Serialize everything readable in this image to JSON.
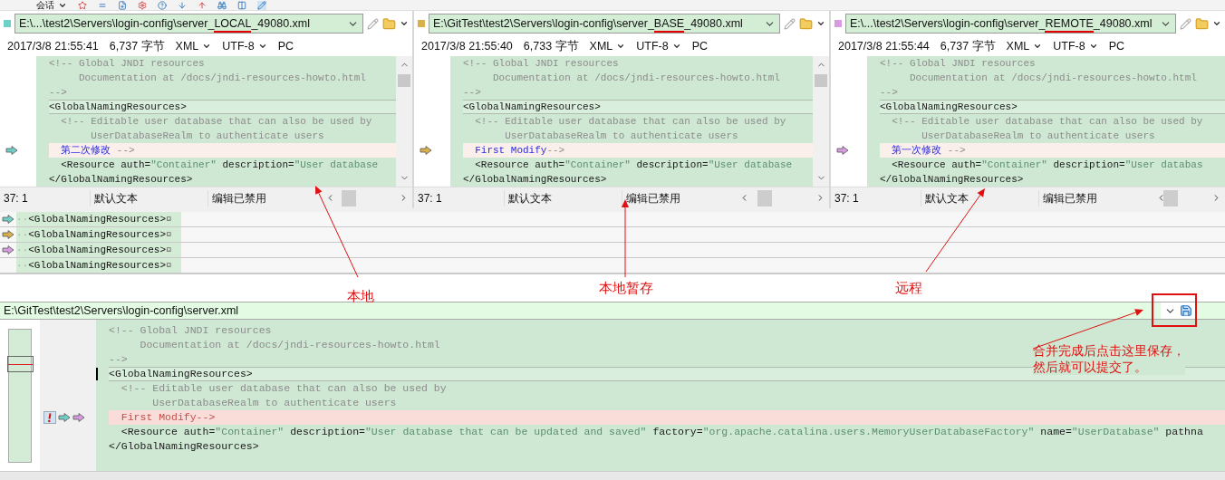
{
  "toolbar": {
    "session_label": "会话"
  },
  "panes": [
    {
      "color": "#6fd0c8",
      "path_parts": [
        "E:\\...\\test2\\Servers\\login-config\\server_",
        "LOCAL",
        "_49080.xml"
      ],
      "info": {
        "timestamp": "2017/3/8 21:55:41",
        "size": "6,737 字节",
        "syntax": "XML",
        "encoding": "UTF-8",
        "line_ending": "PC"
      },
      "lines": [
        {
          "current": false,
          "changed": false,
          "segments": [
            {
              "text": "<!-- Global JNDI resources",
              "kind": "comment"
            }
          ]
        },
        {
          "current": false,
          "changed": false,
          "segments": [
            {
              "text": "     Documentation at /docs/jndi-resources-howto.html",
              "kind": "comment"
            }
          ]
        },
        {
          "current": false,
          "changed": false,
          "segments": [
            {
              "text": "-->",
              "kind": "comment"
            }
          ]
        },
        {
          "current": true,
          "changed": false,
          "segments": [
            {
              "text": "<GlobalNamingResources>",
              "kind": "tag"
            }
          ]
        },
        {
          "current": false,
          "changed": false,
          "segments": [
            {
              "text": "  <!-- Editable user database that can also be used by",
              "kind": "comment"
            }
          ]
        },
        {
          "current": false,
          "changed": false,
          "segments": [
            {
              "text": "       UserDatabaseRealm to authenticate users",
              "kind": "comment"
            }
          ]
        },
        {
          "current": false,
          "changed": true,
          "segments": [
            {
              "text": "  第二次修改",
              "kind": "added"
            },
            {
              "text": " -->",
              "kind": "comment"
            }
          ]
        },
        {
          "current": false,
          "changed": false,
          "segments": [
            {
              "text": "  <Resource auth=",
              "kind": "tag"
            },
            {
              "text": "\"Container\"",
              "kind": "value"
            },
            {
              "text": " description=",
              "kind": "tag"
            },
            {
              "text": "\"User database",
              "kind": "value"
            }
          ]
        },
        {
          "current": false,
          "changed": false,
          "segments": [
            {
              "text": "</GlobalNamingResources>",
              "kind": "tag"
            }
          ]
        }
      ],
      "status": {
        "position": "37: 1",
        "mode": "默认文本",
        "edit_state": "编辑已禁用"
      },
      "annotation": "本地"
    },
    {
      "color": "#d9b04a",
      "path_parts": [
        "E:\\GitTest\\test2\\Servers\\login-config\\server_",
        "BASE",
        "_49080.xml"
      ],
      "info": {
        "timestamp": "2017/3/8 21:55:40",
        "size": "6,733 字节",
        "syntax": "XML",
        "encoding": "UTF-8",
        "line_ending": "PC"
      },
      "lines": [
        {
          "current": false,
          "changed": false,
          "segments": [
            {
              "text": "<!-- Global JNDI resources",
              "kind": "comment"
            }
          ]
        },
        {
          "current": false,
          "changed": false,
          "segments": [
            {
              "text": "     Documentation at /docs/jndi-resources-howto.html",
              "kind": "comment"
            }
          ]
        },
        {
          "current": false,
          "changed": false,
          "segments": [
            {
              "text": "-->",
              "kind": "comment"
            }
          ]
        },
        {
          "current": true,
          "changed": false,
          "segments": [
            {
              "text": "<GlobalNamingResources>",
              "kind": "tag"
            }
          ]
        },
        {
          "current": false,
          "changed": false,
          "segments": [
            {
              "text": "  <!-- Editable user database that can also be used by",
              "kind": "comment"
            }
          ]
        },
        {
          "current": false,
          "changed": false,
          "segments": [
            {
              "text": "       UserDatabaseRealm to authenticate users",
              "kind": "comment"
            }
          ]
        },
        {
          "current": false,
          "changed": true,
          "segments": [
            {
              "text": "  First Modify",
              "kind": "added"
            },
            {
              "text": "-->",
              "kind": "comment"
            }
          ]
        },
        {
          "current": false,
          "changed": false,
          "segments": [
            {
              "text": "  <Resource auth=",
              "kind": "tag"
            },
            {
              "text": "\"Container\"",
              "kind": "value"
            },
            {
              "text": " description=",
              "kind": "tag"
            },
            {
              "text": "\"User database",
              "kind": "value"
            }
          ]
        },
        {
          "current": false,
          "changed": false,
          "segments": [
            {
              "text": "</GlobalNamingResources>",
              "kind": "tag"
            }
          ]
        }
      ],
      "status": {
        "position": "37: 1",
        "mode": "默认文本",
        "edit_state": "编辑已禁用"
      },
      "annotation": "本地暂存"
    },
    {
      "color": "#d89ae0",
      "path_parts": [
        "E:\\...\\test2\\Servers\\login-config\\server_",
        "REMOTE",
        "_49080.xml"
      ],
      "info": {
        "timestamp": "2017/3/8 21:55:44",
        "size": "6,737 字节",
        "syntax": "XML",
        "encoding": "UTF-8",
        "line_ending": "PC"
      },
      "lines": [
        {
          "current": false,
          "changed": false,
          "segments": [
            {
              "text": "<!-- Global JNDI resources",
              "kind": "comment"
            }
          ]
        },
        {
          "current": false,
          "changed": false,
          "segments": [
            {
              "text": "     Documentation at /docs/jndi-resources-howto.html",
              "kind": "comment"
            }
          ]
        },
        {
          "current": false,
          "changed": false,
          "segments": [
            {
              "text": "-->",
              "kind": "comment"
            }
          ]
        },
        {
          "current": true,
          "changed": false,
          "segments": [
            {
              "text": "<GlobalNamingResources>",
              "kind": "tag"
            }
          ]
        },
        {
          "current": false,
          "changed": false,
          "segments": [
            {
              "text": "  <!-- Editable user database that can also be used by",
              "kind": "comment"
            }
          ]
        },
        {
          "current": false,
          "changed": false,
          "segments": [
            {
              "text": "       UserDatabaseRealm to authenticate users",
              "kind": "comment"
            }
          ]
        },
        {
          "current": false,
          "changed": true,
          "segments": [
            {
              "text": "  第一次修改",
              "kind": "added"
            },
            {
              "text": " -->",
              "kind": "comment"
            }
          ]
        },
        {
          "current": false,
          "changed": false,
          "segments": [
            {
              "text": "  <Resource auth=",
              "kind": "tag"
            },
            {
              "text": "\"Container\"",
              "kind": "value"
            },
            {
              "text": " description=",
              "kind": "tag"
            },
            {
              "text": "\"User databas",
              "kind": "value"
            }
          ]
        },
        {
          "current": false,
          "changed": false,
          "segments": [
            {
              "text": "</GlobalNamingResources>",
              "kind": "tag"
            }
          ]
        }
      ],
      "status": {
        "position": "37: 1",
        "mode": "默认文本",
        "edit_state": "编辑已禁用"
      },
      "annotation": "远程"
    }
  ],
  "line_diff": [
    {
      "color": "#6fd0c8",
      "lead": "··",
      "text": "<GlobalNamingResources>",
      "end_mark": "¤"
    },
    {
      "color": "#d9b04a",
      "lead": "··",
      "text": "<GlobalNamingResources>",
      "end_mark": "¤"
    },
    {
      "color": "#d89ae0",
      "lead": "··",
      "text": "<GlobalNamingResources>",
      "end_mark": "¤"
    },
    {
      "lead": "··",
      "text": "<GlobalNamingResources>",
      "end_mark": "¤"
    }
  ],
  "output": {
    "path": "E:\\GitTest\\test2\\Servers\\login-config\\server.xml",
    "lines": [
      {
        "current": false,
        "changed": false,
        "segments": [
          {
            "text": "<!-- Global JNDI resources",
            "kind": "comment"
          }
        ]
      },
      {
        "current": false,
        "changed": false,
        "segments": [
          {
            "text": "     Documentation at /docs/jndi-resources-howto.html",
            "kind": "comment"
          }
        ]
      },
      {
        "current": false,
        "changed": false,
        "segments": [
          {
            "text": "-->",
            "kind": "comment"
          }
        ]
      },
      {
        "current": true,
        "changed": false,
        "segments": [
          {
            "text": "<GlobalNamingResources>",
            "kind": "tag"
          }
        ]
      },
      {
        "current": false,
        "changed": false,
        "segments": [
          {
            "text": "  <!-- Editable user database that can also be used by",
            "kind": "comment"
          }
        ]
      },
      {
        "current": false,
        "changed": false,
        "segments": [
          {
            "text": "       UserDatabaseRealm to authenticate users",
            "kind": "comment"
          }
        ]
      },
      {
        "current": false,
        "changed": true,
        "markers": [
          {
            "kind": "conflict"
          },
          {
            "kind": "arrow",
            "color": "#6fd0c8"
          },
          {
            "kind": "arrow",
            "color": "#d89ae0"
          }
        ],
        "segments": [
          {
            "text": "  First Modify-->",
            "kind": "conflict"
          }
        ]
      },
      {
        "current": false,
        "changed": false,
        "segments": [
          {
            "text": "  <Resource auth=",
            "kind": "tag"
          },
          {
            "text": "\"Container\"",
            "kind": "value"
          },
          {
            "text": " description=",
            "kind": "tag"
          },
          {
            "text": "\"User database that can be updated and saved\"",
            "kind": "value"
          },
          {
            "text": " factory=",
            "kind": "tag"
          },
          {
            "text": "\"org.apache.catalina.users.MemoryUserDatabaseFactory\"",
            "kind": "value"
          },
          {
            "text": " name=",
            "kind": "tag"
          },
          {
            "text": "\"UserDatabase\"",
            "kind": "value"
          },
          {
            "text": " pathna",
            "kind": "tag"
          }
        ]
      },
      {
        "current": false,
        "changed": false,
        "segments": [
          {
            "text": "</GlobalNamingResources>",
            "kind": "tag"
          }
        ]
      }
    ],
    "annotation_note": [
      "合并完成后点击这里保存，",
      "然后就可以提交了。"
    ]
  }
}
